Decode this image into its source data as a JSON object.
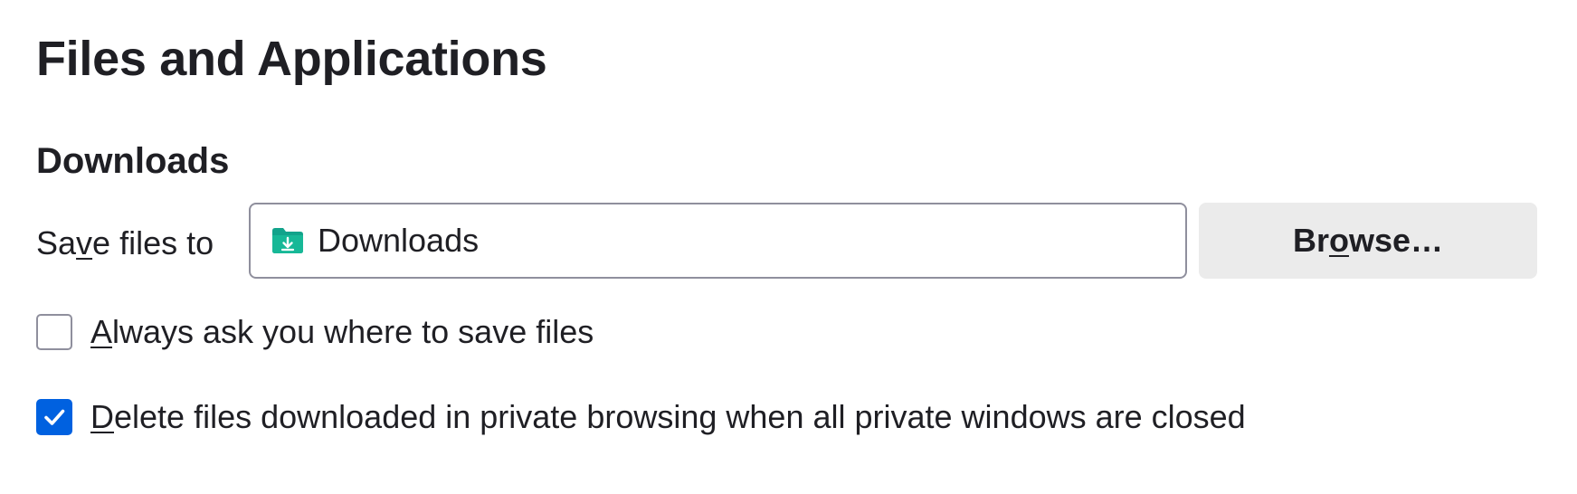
{
  "page_title": "Files and Applications",
  "downloads": {
    "section_title": "Downloads",
    "save_label": {
      "before": "Sa",
      "accesskey": "v",
      "after": "e files to"
    },
    "folder": {
      "icon": "download-folder-icon",
      "value": "Downloads",
      "icon_color": "#12a38b"
    },
    "browse_button": {
      "before": "Br",
      "accesskey": "o",
      "after": "wse…"
    },
    "always_ask": {
      "checked": false,
      "accesskey": "A",
      "after": "lways ask you where to save files"
    },
    "delete_private": {
      "checked": true,
      "accesskey": "D",
      "after": "elete files downloaded in private browsing when all private windows are closed"
    }
  },
  "colors": {
    "accent": "#0061e0",
    "text": "#1f1f24",
    "button_bg": "#ebebeb",
    "border": "#8f8f9d"
  }
}
